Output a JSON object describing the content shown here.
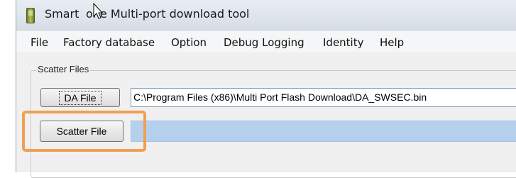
{
  "window": {
    "title": "SmartPhone Multi-port download tool",
    "title_visible": "Smart   one Multi-port download tool"
  },
  "menu": {
    "items": [
      {
        "label": "File"
      },
      {
        "label": "Factory database"
      },
      {
        "label": "Option"
      },
      {
        "label": "Debug Logging"
      },
      {
        "label": "Identity"
      },
      {
        "label": "Help"
      }
    ]
  },
  "scatter_group": {
    "label": "Scatter Files",
    "da_button_label": "DA File",
    "da_path": "C:\\Program Files (x86)\\Multi Port Flash Download\\DA_SWSEC.bin",
    "scatter_button_label": "Scatter File",
    "scatter_path": ""
  },
  "colors": {
    "highlight": "#f0a052",
    "scatter_field_bg": "#b5d0ec"
  },
  "icons": {
    "app": "phone-app-icon",
    "cursor": "mouse-pointer-icon"
  }
}
